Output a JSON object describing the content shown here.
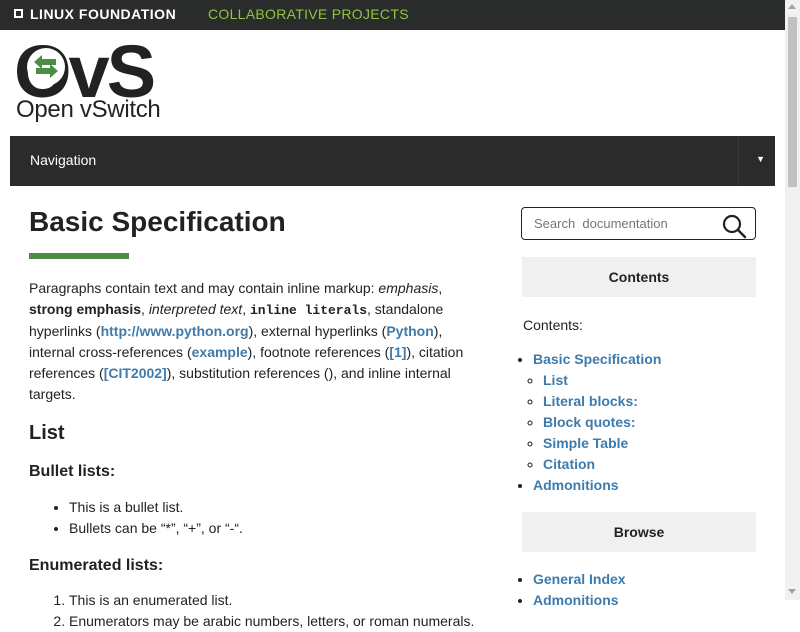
{
  "topbar": {
    "org_name": "LINUX FOUNDATION",
    "tagline": "COLLABORATIVE PROJECTS",
    "accent_color": "#8dc63f"
  },
  "logo": {
    "mark": "OvS",
    "name": "Open vSwitch",
    "arrows_color": "#4c8c45"
  },
  "navbar": {
    "toggle_label": "Navigation",
    "caret_icon": "caret-down-icon"
  },
  "main": {
    "title": "Basic Specification",
    "accent_color": "#4c8c45",
    "intro": {
      "t1": "Paragraphs contain text and may contain inline markup: ",
      "emphasis": "emphasis",
      "t2": ", ",
      "strong": "strong emphasis",
      "t3": ", ",
      "interpreted": "interpreted text",
      "t4": ", ",
      "literal": "inline literals",
      "t5": ", standalone hyperlinks (",
      "link_python_org": "http://www.python.org",
      "t6": "), external hyperlinks (",
      "link_python": "Python",
      "t7": "), internal cross-references (",
      "link_example": "example",
      "t8": "), footnote references (",
      "link_footnote": "[1]",
      "t9": "), citation references (",
      "link_citation": "[CIT2002]",
      "t10": "), substitution references (), and inline internal targets."
    },
    "list_heading": "List",
    "bullet_heading": "Bullet lists:",
    "bullets": [
      "This is a bullet list.",
      "Bullets can be “*”, “+”, or “-“."
    ],
    "enum_heading": "Enumerated lists:",
    "enumerated": [
      "This is an enumerated list.",
      "Enumerators may be arabic numbers, letters, or roman numerals."
    ]
  },
  "sidebar": {
    "search_placeholder": "Search  documentation",
    "contents_header": "Contents",
    "contents_label": "Contents:",
    "toc": {
      "top": "Basic Specification",
      "children": [
        "List",
        "Literal blocks:",
        "Block quotes:",
        "Simple Table",
        "Citation"
      ],
      "second": "Admonitions"
    },
    "browse_header": "Browse",
    "browse_items": [
      "General Index",
      "Admonitions"
    ]
  }
}
